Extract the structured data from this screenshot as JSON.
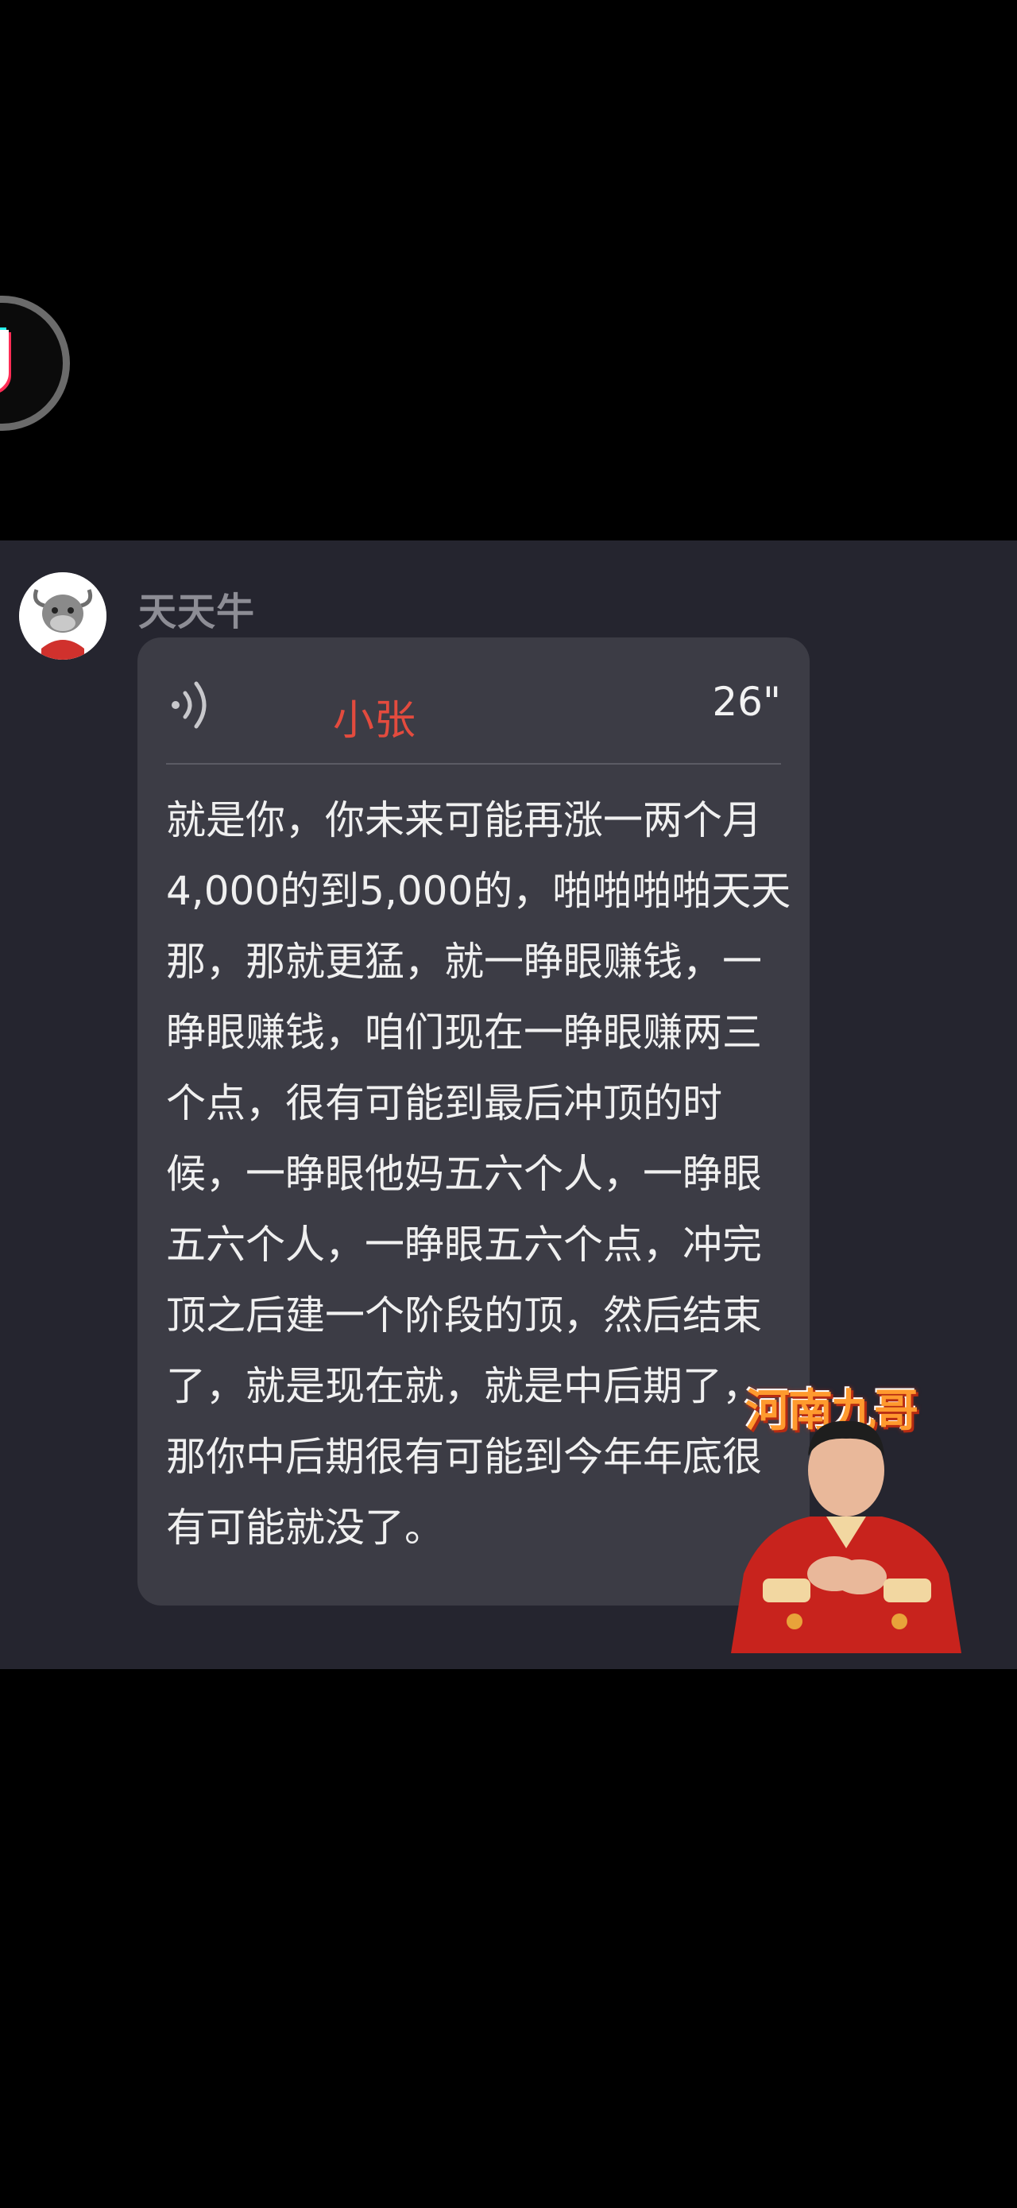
{
  "message": {
    "sender_name": "天天牛",
    "contact_tag": "小张",
    "duration": "26\"",
    "transcript": "就是你，你未来可能再涨一两个月4,000的到5,000的，啪啪啪啪天天那，那就更猛，就一睁眼赚钱，一睁眼赚钱，咱们现在一睁眼赚两三个点，很有可能到最后冲顶的时候，一睁眼他妈五六个人，一睁眼五六个人，一睁眼五六个点，冲完顶之后建一个阶段的顶，然后结束了，就是现在就，就是中后期了，那你中后期很有可能到今年年底很有可能就没了。"
  },
  "overlay": {
    "streamer_label": "河南九哥"
  },
  "icons": {
    "app_logo": "tiktok-logo-icon",
    "avatar": "bull-avatar-icon",
    "voice": "voice-wave-icon"
  },
  "colors": {
    "background": "#000000",
    "chat_panel": "#25252f",
    "bubble": "#3c3c45",
    "contact_tag": "#e34b3e",
    "sender_name": "#8d8d95"
  }
}
